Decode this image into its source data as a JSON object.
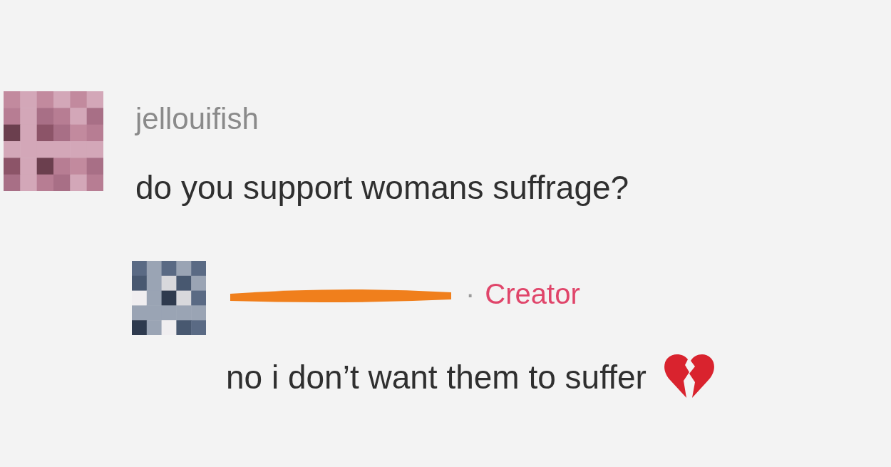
{
  "comment": {
    "author": "jellouifish",
    "text": "do you support womans suffrage?"
  },
  "reply": {
    "separator": "·",
    "badge": "Creator",
    "text": "no i don’t want them to suffer"
  }
}
